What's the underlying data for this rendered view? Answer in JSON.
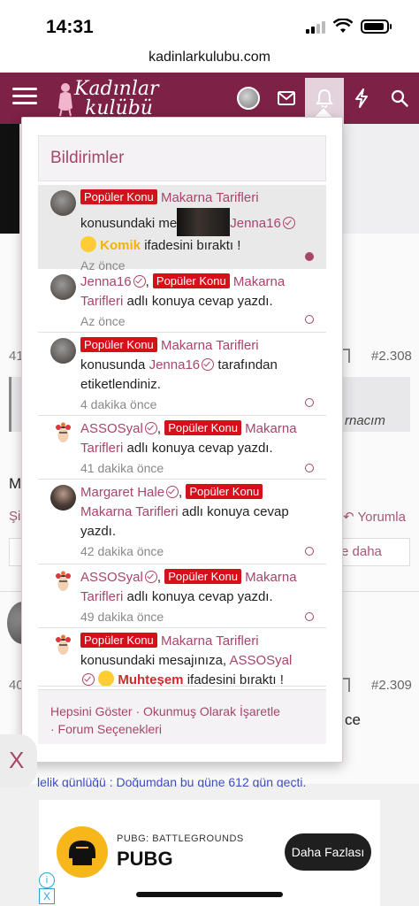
{
  "status_bar": {
    "time": "14:31"
  },
  "browser": {
    "url": "kadinlarkulubu.com"
  },
  "site": {
    "logo_line1": "Kadınlar",
    "logo_line2": "kulübü",
    "colors": {
      "header": "#7d2146",
      "accent": "#a8456b",
      "badge": "#d4101b"
    },
    "icons": [
      "menu-icon",
      "user-avatar",
      "envelope-icon",
      "bell-icon",
      "lightning-icon",
      "search-icon"
    ]
  },
  "background": {
    "post_num_1": "#2.308",
    "post_num_2": "#2.309",
    "post_count_1": "41",
    "post_count_2": "40",
    "cut_m": "M",
    "cut_si": "Şi",
    "reply_label": "Yorumla",
    "more_label": "e daha",
    "quote_fragment": "rnacım",
    "ce_fragment": "ce"
  },
  "notifications": {
    "title": "Bildirimler",
    "items": [
      {
        "badge": "Popüler Konu",
        "thread": "Makarna Tarifleri",
        "text_a": "konusundaki me",
        "user": "Jenna16",
        "reaction": "Komik",
        "text_b": "ifadesini bıraktı !",
        "time": "Az önce"
      },
      {
        "user": "Jenna16",
        "comma": ",",
        "badge": "Popüler Konu",
        "thread": "Makarna Tarifleri",
        "text_a": "adlı konuya cevap yazdı.",
        "time": "Az önce"
      },
      {
        "badge": "Popüler Konu",
        "thread": "Makarna Tarifleri",
        "text_a": "konusunda",
        "user": "Jenna16",
        "text_b": "tarafından etiketlendiniz.",
        "time": "4 dakika önce"
      },
      {
        "user": "ASSOSyal",
        "comma": ",",
        "badge": "Popüler Konu",
        "thread": "Makarna Tarifleri",
        "text_a": "adlı konuya cevap yazdı.",
        "time": "41 dakika önce"
      },
      {
        "user": "Margaret Hale",
        "comma": ",",
        "badge": "Popüler Konu",
        "thread": "Makarna Tarifleri",
        "text_a": "adlı konuya cevap yazdı.",
        "time": "42 dakika önce"
      },
      {
        "user": "ASSOSyal",
        "comma": ",",
        "badge": "Popüler Konu",
        "thread": "Makarna Tarifleri",
        "text_a": "adlı konuya cevap yazdı.",
        "time": "49 dakika önce"
      },
      {
        "badge": "Popüler Konu",
        "thread": "Makarna Tarifleri",
        "text_a": "konusundaki mesajınıza,",
        "user": "ASSOSyal",
        "reaction": "Muhteşem",
        "text_b": "ifadesini bıraktı !"
      }
    ],
    "footer": {
      "show_all": "Hepsini Göster",
      "sep": " · ",
      "mark_read": "Okunmuş Olarak İşaretle",
      "forum_prefs": "· Forum Seçenekleri"
    }
  },
  "ad": {
    "close_label": "X",
    "marquee": "lelik günlüğü : Doğumdan bu güne 612 gün geçti.",
    "sponsor": "PUBG: BATTLEGROUNDS",
    "title": "PUBG",
    "cta": "Daha Fazlası",
    "info": "i",
    "dismiss": "X"
  }
}
